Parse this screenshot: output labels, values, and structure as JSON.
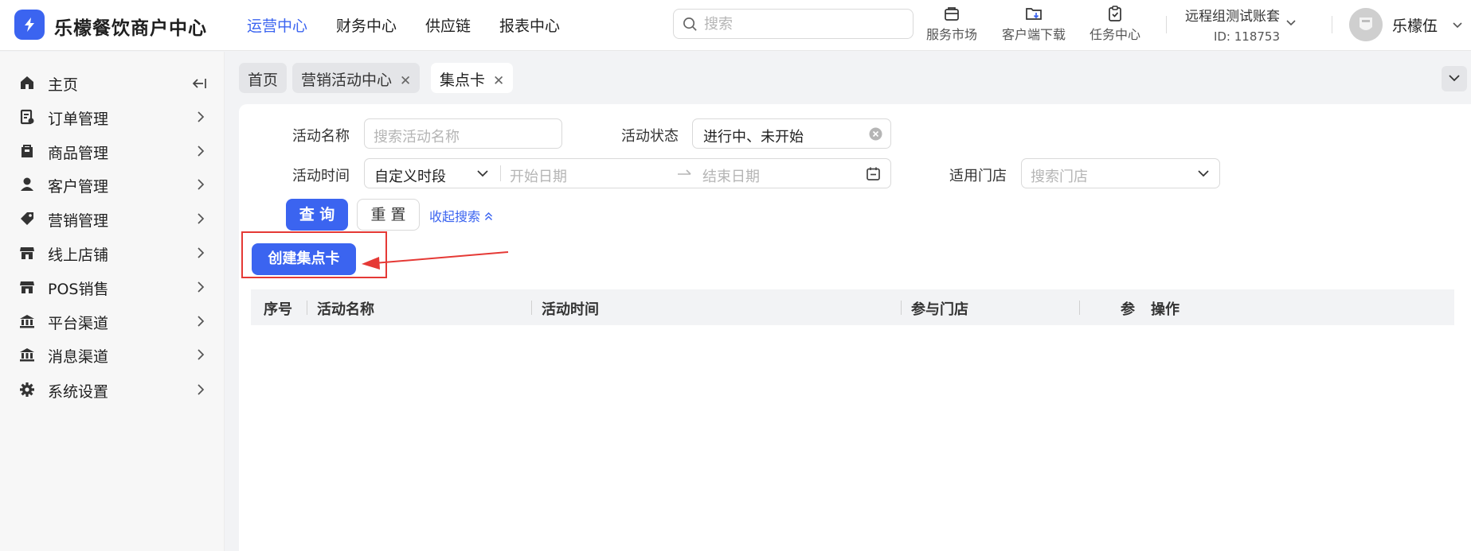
{
  "header": {
    "brand": "乐檬餐饮商户中心",
    "nav": [
      {
        "label": "运营中心",
        "active": true
      },
      {
        "label": "财务中心",
        "active": false
      },
      {
        "label": "供应链",
        "active": false
      },
      {
        "label": "报表中心",
        "active": false
      }
    ],
    "search_placeholder": "搜索",
    "tools": [
      {
        "label": "服务市场",
        "icon": "store-bag-icon"
      },
      {
        "label": "客户端下载",
        "icon": "download-folder-icon"
      },
      {
        "label": "任务中心",
        "icon": "clipboard-check-icon"
      }
    ],
    "account_name": "远程组测试账套",
    "account_id": "ID: 118753",
    "user_name": "乐檬伍"
  },
  "sidebar": {
    "items": [
      {
        "label": "主页",
        "icon": "home-icon"
      },
      {
        "label": "订单管理",
        "icon": "order-icon"
      },
      {
        "label": "商品管理",
        "icon": "goods-icon"
      },
      {
        "label": "客户管理",
        "icon": "user-icon"
      },
      {
        "label": "营销管理",
        "icon": "tag-icon"
      },
      {
        "label": "线上店铺",
        "icon": "shop-icon"
      },
      {
        "label": "POS销售",
        "icon": "pos-icon"
      },
      {
        "label": "平台渠道",
        "icon": "bank-icon"
      },
      {
        "label": "消息渠道",
        "icon": "bank-icon"
      },
      {
        "label": "系统设置",
        "icon": "gear-icon"
      }
    ]
  },
  "tabs": [
    {
      "label": "首页",
      "closable": false,
      "active": false
    },
    {
      "label": "营销活动中心",
      "closable": true,
      "active": false
    },
    {
      "label": "集点卡",
      "closable": true,
      "active": true
    }
  ],
  "filters": {
    "activity_name_label": "活动名称",
    "activity_name_placeholder": "搜索活动名称",
    "activity_status_label": "活动状态",
    "activity_status_value": "进行中、未开始",
    "activity_time_label": "活动时间",
    "time_range_type": "自定义时段",
    "start_date_placeholder": "开始日期",
    "end_date_placeholder": "结束日期",
    "store_label": "适用门店",
    "store_placeholder": "搜索门店"
  },
  "actions": {
    "query_label": "查 询",
    "reset_label": "重 置",
    "collapse_label": "收起搜索",
    "create_label": "创建集点卡"
  },
  "table": {
    "columns": [
      "序号",
      "活动名称",
      "活动时间",
      "参与门店",
      "参",
      "操作"
    ],
    "rows": []
  },
  "colors": {
    "accent": "#3b64f0",
    "annotation_red": "#e53935"
  }
}
